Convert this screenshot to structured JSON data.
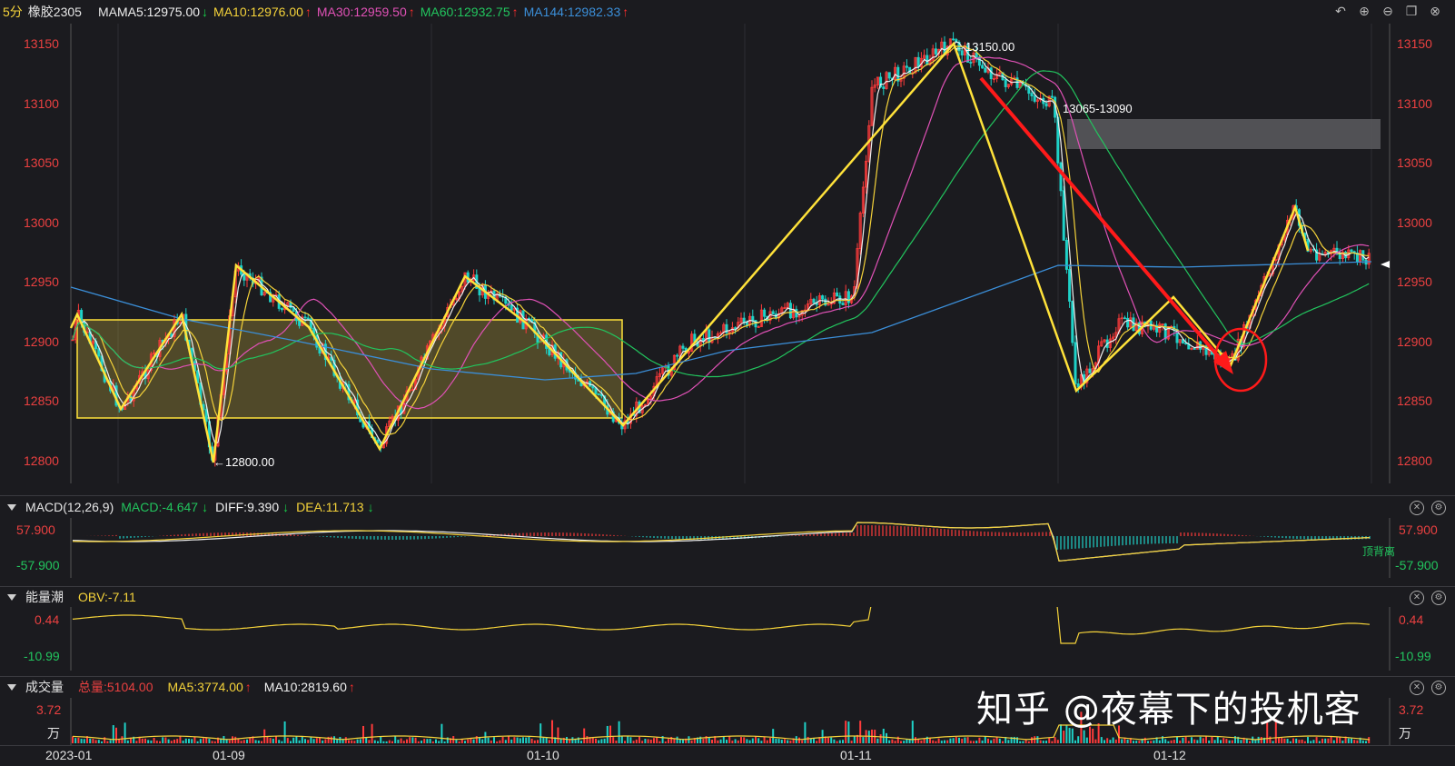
{
  "header": {
    "period": "5分",
    "symbol": "橡胶2305",
    "ma_label": "MA",
    "ma5": "MA5:12975.00",
    "ma10": "MA10:12976.00",
    "ma30": "MA30:12959.50",
    "ma60": "MA60:12932.75",
    "ma144": "MA144:12982.33"
  },
  "colors": {
    "ma5": "#f0f0f0",
    "ma10": "#f5d33a",
    "ma30": "#e051b6",
    "ma60": "#22c55e",
    "ma144": "#3b8fd9",
    "up": "#ff3b3b",
    "down": "#1fd2c8",
    "price_axis": "#e94040",
    "annot": "#ffe23a",
    "arrow": "#ff1a1a"
  },
  "price_axis": {
    "ticks": [
      "13150",
      "13100",
      "13050",
      "13000",
      "12950",
      "12900",
      "12850",
      "12800"
    ]
  },
  "annotations": {
    "high_label": "←13150.00",
    "low_label": "←12800.00",
    "zone_label": "13065-13090"
  },
  "macd": {
    "title": "MACD(12,26,9)",
    "macd": "MACD:-4.647",
    "diff": "DIFF:9.390",
    "dea": "DEA:11.713",
    "top": "57.900",
    "bottom": "-57.900",
    "note": "顶背离"
  },
  "obv": {
    "title": "能量潮",
    "value": "OBV:-7.11",
    "top": "0.44",
    "bottom": "-10.99"
  },
  "volume": {
    "title": "成交量",
    "total": "总量:5104.00",
    "ma5": "MA5:3774.00",
    "ma10": "MA10:2819.60",
    "top": "3.72",
    "unit": "万"
  },
  "dates": [
    "2023-01",
    "01-09",
    "01-10",
    "01-11",
    "01-12"
  ],
  "icons": [
    "undo-icon",
    "zoom-in-icon",
    "zoom-out-icon",
    "window-icon",
    "close-icon"
  ],
  "watermark": "知乎 @夜幕下的投机客"
}
